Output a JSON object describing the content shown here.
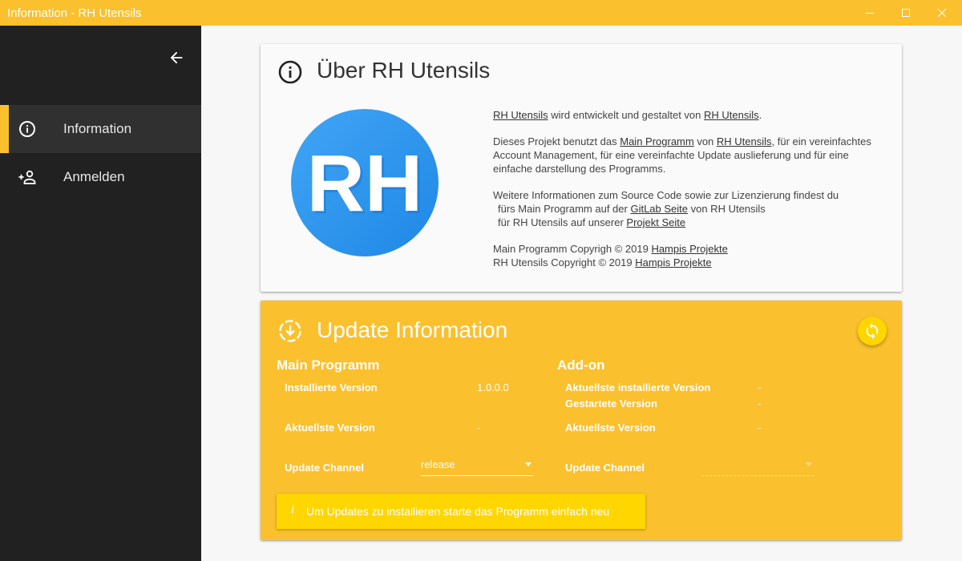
{
  "window": {
    "title": "Information - RH Utensils"
  },
  "sidebar": {
    "items": [
      {
        "label": "Information",
        "icon": "info-icon",
        "active": true
      },
      {
        "label": "Anmelden",
        "icon": "account-plus-icon",
        "active": false
      }
    ]
  },
  "about": {
    "title": "Über RH Utensils",
    "logo_text": "RH",
    "p1": {
      "link1": "RH Utensils",
      "text1": " wird entwickelt und gestaltet von ",
      "link2": "RH Utensils",
      "text2": "."
    },
    "p2": {
      "text1": "Dieses Projekt benutzt das ",
      "link1": "Main Programm",
      "text2": " von ",
      "link2": "RH Utensils",
      "text3": ", für ein vereinfachtes Account Management, für eine vereinfachte Update auslieferung und für eine einfache darstellung des Programms."
    },
    "p3": {
      "line1": "Weitere Informationen zum Source Code sowie zur Lizenzierung findest du",
      "line2_pre": "fürs Main Programm auf der ",
      "line2_link": "GitLab Seite",
      "line2_post": " von RH Utensils",
      "line3_pre": "für RH Utensils auf unserer ",
      "line3_link": "Projekt Seite"
    },
    "copyright1": {
      "text": "Main Programm Copyrigh © 2019 ",
      "link": "Hampis Projekte"
    },
    "copyright2": {
      "text": "RH Utensils Copyright © 2019 ",
      "link": "Hampis Projekte"
    }
  },
  "update": {
    "title": "Update Information",
    "main": {
      "title": "Main Programm",
      "installed_label": "Installierte Version",
      "installed_value": "1.0.0.0",
      "latest_label": "Aktuellste Version",
      "latest_value": "-",
      "channel_label": "Update Channel",
      "channel_value": "release"
    },
    "addon": {
      "title": "Add-on",
      "installed_label": "Aktuellste installierte Version",
      "installed_value": "-",
      "started_label": "Gestartete Version",
      "started_value": "-",
      "latest_label": "Aktuellste Version",
      "latest_value": "-",
      "channel_label": "Update Channel"
    },
    "notice": {
      "icon": "i",
      "text": "Um Updates zu installieren starte das Programm einfach neu"
    }
  },
  "colors": {
    "accent": "#fbc02d",
    "sidebar": "#212121",
    "logo": "#2196f3"
  }
}
